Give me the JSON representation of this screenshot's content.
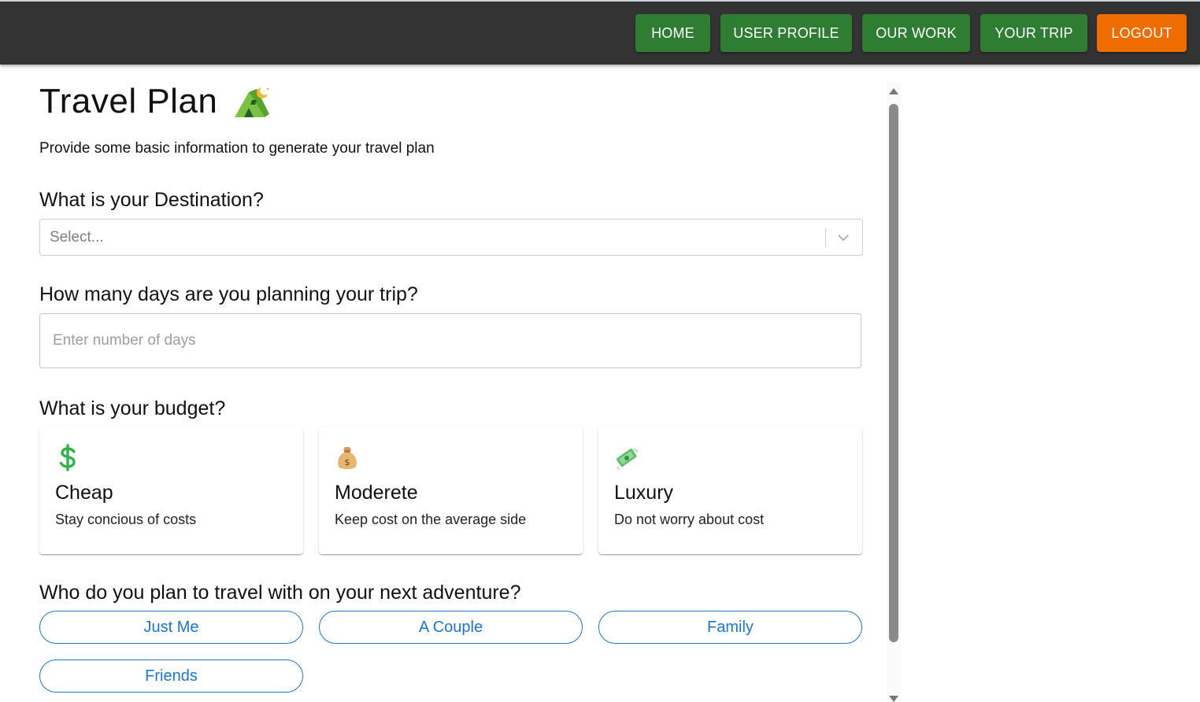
{
  "nav": {
    "items": [
      {
        "label": "HOME"
      },
      {
        "label": "USER PROFILE"
      },
      {
        "label": "OUR WORK"
      },
      {
        "label": "YOUR TRIP"
      },
      {
        "label": "LOGOUT"
      }
    ],
    "colors": {
      "bar": "#333333",
      "primary": "#2e7d32",
      "logout": "#ef6c00"
    }
  },
  "page": {
    "title": "Travel Plan",
    "title_icon": "tent-icon",
    "subtitle": "Provide some basic information to generate your travel plan"
  },
  "destination": {
    "question": "What is your Destination?",
    "placeholder": "Select..."
  },
  "days": {
    "question": "How many days are you planning your trip?",
    "placeholder": "Enter number of days",
    "value": ""
  },
  "budget": {
    "question": "What is your budget?",
    "options": [
      {
        "icon": "dollar-sign-icon",
        "title": "Cheap",
        "desc": "Stay concious of costs"
      },
      {
        "icon": "money-bag-icon",
        "title": "Moderete",
        "desc": "Keep cost on the average side"
      },
      {
        "icon": "money-with-wings-icon",
        "title": "Luxury",
        "desc": "Do not worry about cost"
      }
    ]
  },
  "companions": {
    "question": "Who do you plan to travel with on your next adventure?",
    "options": [
      {
        "label": "Just Me"
      },
      {
        "label": "A Couple"
      },
      {
        "label": "Family"
      },
      {
        "label": "Friends"
      }
    ],
    "accent": "#1976d2"
  }
}
